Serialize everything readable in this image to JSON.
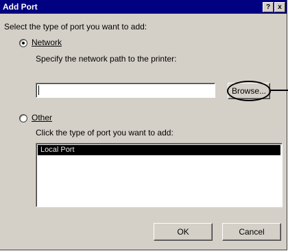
{
  "window": {
    "title": "Add Port",
    "help_button": "?",
    "close_button": "x"
  },
  "prompt": "Select the type of port you want to add:",
  "network": {
    "option_label": "Network",
    "selected": true,
    "instruction": "Specify the network path to the printer:",
    "path_value": "",
    "browse_label": "Browse..."
  },
  "other": {
    "option_label": "Other",
    "selected": false,
    "instruction": "Click the type of port you want to add:",
    "port_types": [
      "Local Port"
    ]
  },
  "buttons": {
    "ok": "OK",
    "cancel": "Cancel"
  }
}
